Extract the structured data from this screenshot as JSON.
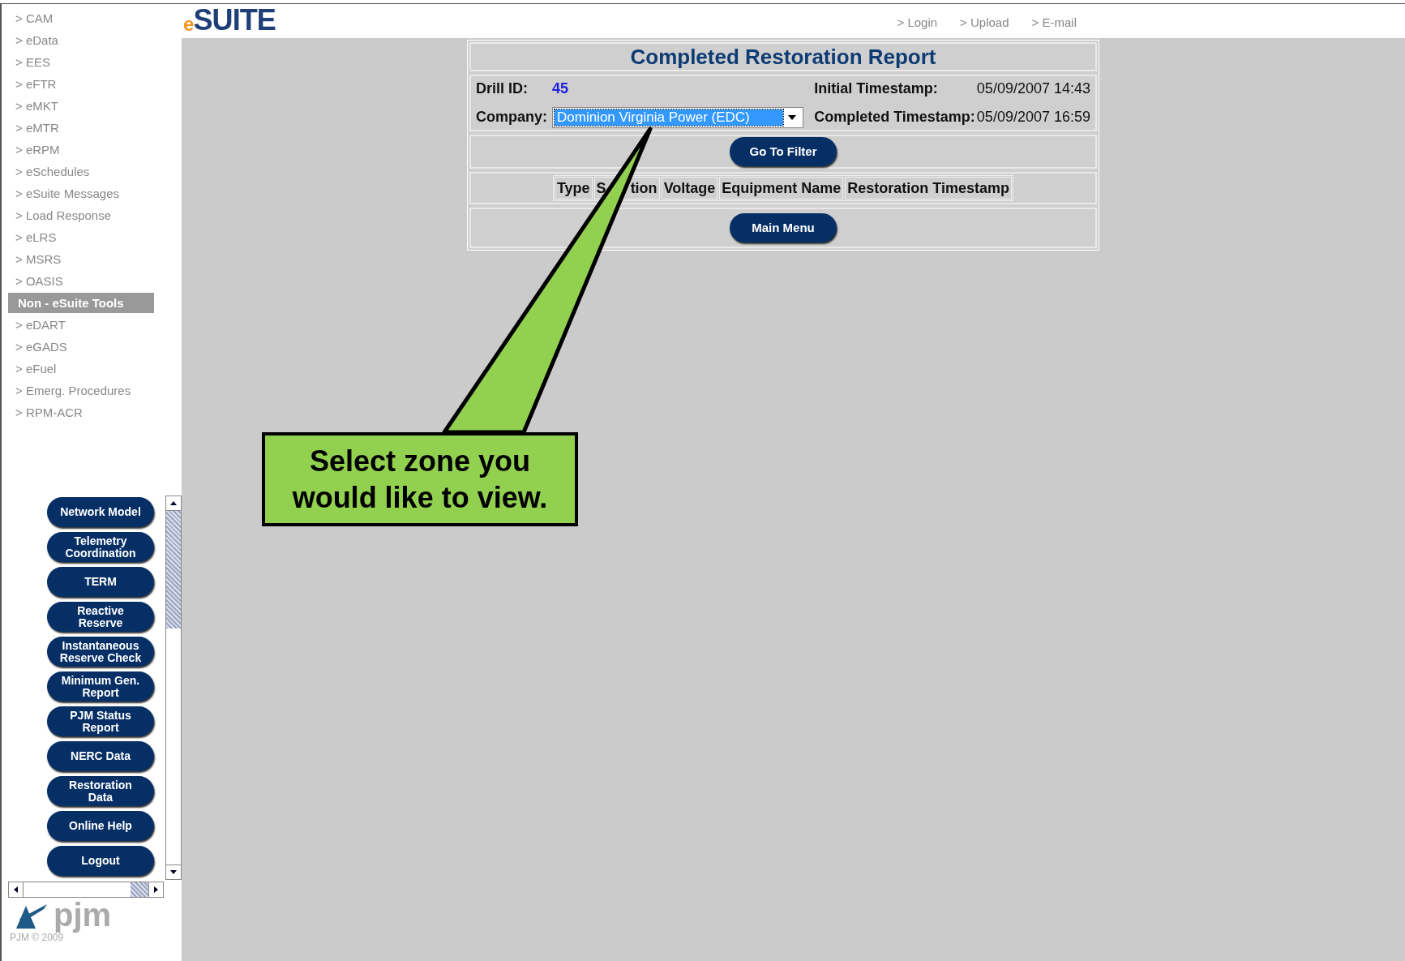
{
  "sidebar": {
    "menu": [
      {
        "label": "> CAM",
        "kind": "link"
      },
      {
        "label": "> eData",
        "kind": "link"
      },
      {
        "label": "> EES",
        "kind": "link"
      },
      {
        "label": "> eFTR",
        "kind": "link"
      },
      {
        "label": "> eMKT",
        "kind": "link"
      },
      {
        "label": "> eMTR",
        "kind": "link"
      },
      {
        "label": "> eRPM",
        "kind": "link"
      },
      {
        "label": "> eSchedules",
        "kind": "link"
      },
      {
        "label": "> eSuite Messages",
        "kind": "link"
      },
      {
        "label": "> Load Response",
        "kind": "link"
      },
      {
        "label": "> eLRS",
        "kind": "link"
      },
      {
        "label": "> MSRS",
        "kind": "link"
      },
      {
        "label": "> OASIS",
        "kind": "link"
      },
      {
        "label": "Non - eSuite Tools",
        "kind": "heading"
      },
      {
        "label": "> eDART",
        "kind": "link"
      },
      {
        "label": "> eGADS",
        "kind": "link"
      },
      {
        "label": "> eFuel",
        "kind": "link"
      },
      {
        "label": "> Emerg. Procedures",
        "kind": "link"
      },
      {
        "label": "> RPM-ACR",
        "kind": "link"
      }
    ],
    "buttons": [
      "Network Model",
      "Telemetry Coordination",
      "TERM",
      "Reactive Reserve",
      "Instantaneous Reserve Check",
      "Minimum Gen. Report",
      "PJM Status Report",
      "NERC Data",
      "Restoration Data",
      "Online Help",
      "Logout"
    ],
    "logo": "pjm",
    "footer": "PJM © 2009"
  },
  "header": {
    "logo": {
      "prefix": "e",
      "name": "SUITE"
    },
    "links": [
      "> Login",
      "> Upload",
      "> E-mail"
    ]
  },
  "report": {
    "title": "Completed Restoration Report",
    "drill_id_label": "Drill ID:",
    "drill_id": "45",
    "initial_label": "Initial Timestamp:",
    "initial_value": "05/09/2007 14:43",
    "company_label": "Company:",
    "company_value": "Dominion Virginia Power (EDC)",
    "completed_label": "Completed Timestamp:",
    "completed_value": "05/09/2007 16:59",
    "filter_button": "Go To Filter",
    "columns": [
      {
        "parts": [
          "Type"
        ]
      },
      {
        "parts": [
          "S",
          "tion"
        ]
      },
      {
        "parts": [
          "Voltage"
        ]
      },
      {
        "parts": [
          "Equipment Name"
        ]
      },
      {
        "parts": [
          "Restoration Timestamp"
        ]
      }
    ],
    "menu_button": "Main Menu"
  },
  "callout": {
    "text": "Select zone you would like to view."
  }
}
